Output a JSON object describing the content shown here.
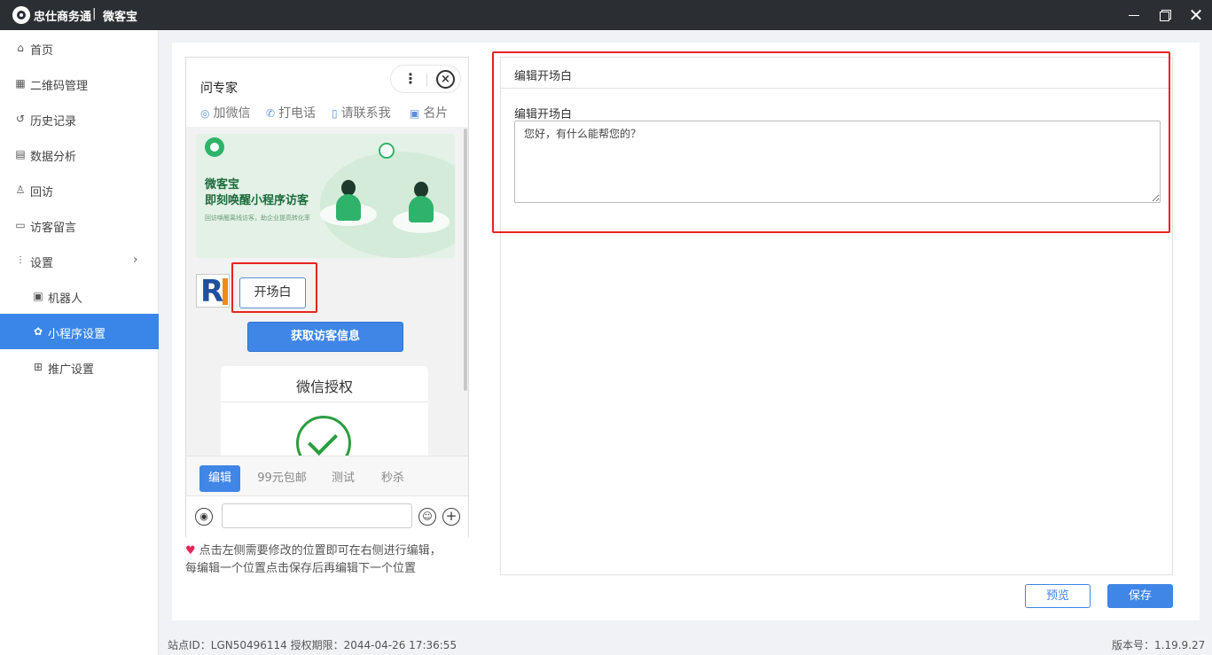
{
  "window": {
    "app_title": "忠仕商务通",
    "separator": "|",
    "sub_title": "微客宝",
    "close_glyph": "✕"
  },
  "sidebar": {
    "items": [
      {
        "label": "首页",
        "icon": "home-icon",
        "glyph": "⌂"
      },
      {
        "label": "二维码管理",
        "icon": "qrcode-icon",
        "glyph": "▦"
      },
      {
        "label": "历史记录",
        "icon": "history-icon",
        "glyph": "↺"
      },
      {
        "label": "数据分析",
        "icon": "chart-icon",
        "glyph": "▤"
      },
      {
        "label": "回访",
        "icon": "user-icon",
        "glyph": "♙"
      },
      {
        "label": "访客留言",
        "icon": "message-icon",
        "glyph": "▭"
      },
      {
        "label": "设置",
        "icon": "settings-icon",
        "glyph": "⫶",
        "chevron": "›"
      },
      {
        "label": "机器人",
        "icon": "robot-icon",
        "glyph": "▣"
      },
      {
        "label": "小程序设置",
        "icon": "gear-icon",
        "glyph": "✿",
        "active": true
      },
      {
        "label": "推广设置",
        "icon": "grid-icon",
        "glyph": "⊞"
      }
    ]
  },
  "phone": {
    "title": "问专家",
    "capsule_dots": "⋮",
    "capsule_close": "×",
    "contacts": [
      {
        "label": "加微信",
        "glyph": "◎"
      },
      {
        "label": "打电话",
        "glyph": "✆"
      },
      {
        "label": "请联系我",
        "glyph": "▯"
      },
      {
        "label": "名片",
        "glyph": "▣"
      }
    ],
    "banner": {
      "line1": "微客宝",
      "line2": "即刻唤醒小程序访客",
      "line3": "回访唤醒离线访客，助企业提高转化率"
    },
    "avatar_letter": "R",
    "greeting_bubble": "开场白",
    "visitor_button": "获取访客信息",
    "auth_card_title": "微信授权",
    "tabs": [
      "编辑",
      "99元包邮",
      "测试",
      "秒杀"
    ],
    "input_icons": {
      "voice": "◉",
      "emoji": "☺",
      "plus": "+"
    }
  },
  "hint": {
    "heart": "♥",
    "line1": "点击左侧需要修改的位置即可在右侧进行编辑，",
    "line2": "每编辑一个位置点击保存后再编辑下一个位置"
  },
  "editor": {
    "header": "编辑开场白",
    "field_label": "编辑开场白",
    "field_value": "您好，有什么能帮您的？"
  },
  "actions": {
    "preview": "预览",
    "save": "保存"
  },
  "status": {
    "site_info": "站点ID：LGN50496114 授权期限：2044-04-26 17:36:55",
    "version": "版本号：1.19.9.27"
  },
  "colors": {
    "accent": "#3f86e6",
    "highlight": "#e8231f",
    "titlebar": "#2b2f33",
    "banner_green": "#2fb36b"
  }
}
